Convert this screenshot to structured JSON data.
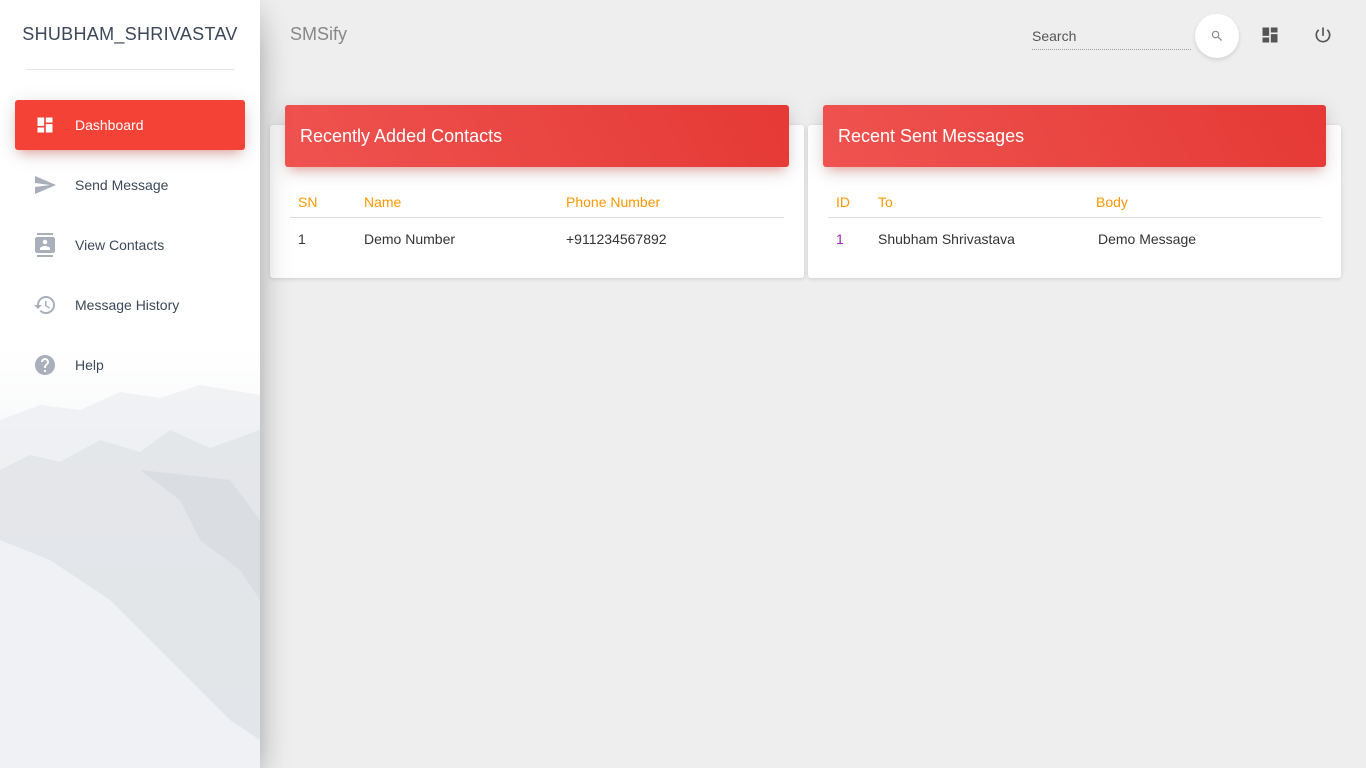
{
  "sidebar": {
    "brand": "SHUBHAM_SHRIVASTAV",
    "items": [
      {
        "label": "Dashboard",
        "icon": "dashboard-icon",
        "active": true
      },
      {
        "label": "Send Message",
        "icon": "send-icon",
        "active": false
      },
      {
        "label": "View Contacts",
        "icon": "contacts-icon",
        "active": false
      },
      {
        "label": "Message History",
        "icon": "history-icon",
        "active": false
      },
      {
        "label": "Help",
        "icon": "help-icon",
        "active": false
      }
    ]
  },
  "header": {
    "title": "SMSify",
    "search": {
      "placeholder": "Search",
      "value": ""
    },
    "icons": [
      "search-icon",
      "dashboard-icon",
      "power-icon"
    ]
  },
  "contacts_card": {
    "title": "Recently Added Contacts",
    "columns": [
      "SN",
      "Name",
      "Phone Number"
    ],
    "rows": [
      [
        "1",
        "Demo Number",
        "+911234567892"
      ]
    ]
  },
  "messages_card": {
    "title": "Recent Sent Messages",
    "columns": [
      "ID",
      "To",
      "Body"
    ],
    "rows": [
      [
        "1",
        "Shubham Shrivastava",
        "Demo Message"
      ]
    ]
  },
  "colors": {
    "accent": "#f44336",
    "header_gradient_start": "#ef5350",
    "header_gradient_end": "#e53935",
    "table_header_text": "#ff9800",
    "id_link": "#9c27b0",
    "page_background": "#eeeeee"
  }
}
